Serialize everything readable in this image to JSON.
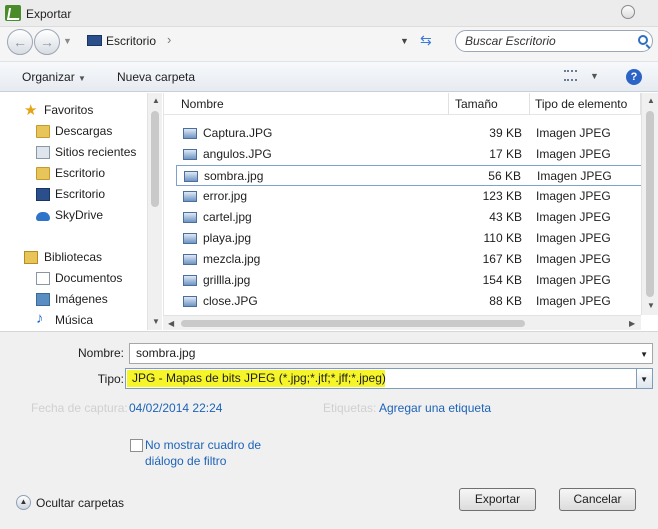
{
  "window": {
    "title": "Exportar"
  },
  "address": {
    "location": "Escritorio",
    "search_placeholder": "Buscar Escritorio"
  },
  "toolbar": {
    "organize": "Organizar",
    "new_folder": "Nueva carpeta"
  },
  "nav": {
    "favorites": "Favoritos",
    "items_fav": [
      "Descargas",
      "Sitios recientes",
      "Escritorio",
      "Escritorio",
      "SkyDrive"
    ],
    "libraries": "Bibliotecas",
    "items_lib": [
      "Documentos",
      "Imágenes",
      "Música"
    ]
  },
  "columns": {
    "name": "Nombre",
    "size": "Tamaño",
    "type": "Tipo de elemento"
  },
  "files": [
    {
      "name": "Captura.JPG",
      "size": "39 KB",
      "type": "Imagen JPEG"
    },
    {
      "name": "angulos.JPG",
      "size": "17 KB",
      "type": "Imagen JPEG"
    },
    {
      "name": "sombra.jpg",
      "size": "56 KB",
      "type": "Imagen JPEG",
      "selected": true
    },
    {
      "name": "error.jpg",
      "size": "123 KB",
      "type": "Imagen JPEG"
    },
    {
      "name": "cartel.jpg",
      "size": "43 KB",
      "type": "Imagen JPEG"
    },
    {
      "name": "playa.jpg",
      "size": "110 KB",
      "type": "Imagen JPEG"
    },
    {
      "name": "mezcla.jpg",
      "size": "167 KB",
      "type": "Imagen JPEG"
    },
    {
      "name": "grillla.jpg",
      "size": "154 KB",
      "type": "Imagen JPEG"
    },
    {
      "name": "close.JPG",
      "size": "88 KB",
      "type": "Imagen JPEG"
    }
  ],
  "form": {
    "name_label": "Nombre:",
    "name_value": "sombra.jpg",
    "type_label": "Tipo:",
    "type_value": "JPG - Mapas de bits JPEG (*.jpg;*.jtf;*.jff;*.jpeg)",
    "capture_label": "Fecha de captura:",
    "capture_value": "04/02/2014 22:24",
    "tags_label": "Etiquetas:",
    "tags_value": "Agregar una etiqueta",
    "checkbox_line1": "No mostrar cuadro de",
    "checkbox_line2": "diálogo de filtro"
  },
  "footer": {
    "hide_folders": "Ocultar carpetas",
    "export": "Exportar",
    "cancel": "Cancelar"
  },
  "colors": {
    "highlight": "#f5f52a",
    "link": "#1d63b8",
    "accent": "#2b64c6"
  }
}
